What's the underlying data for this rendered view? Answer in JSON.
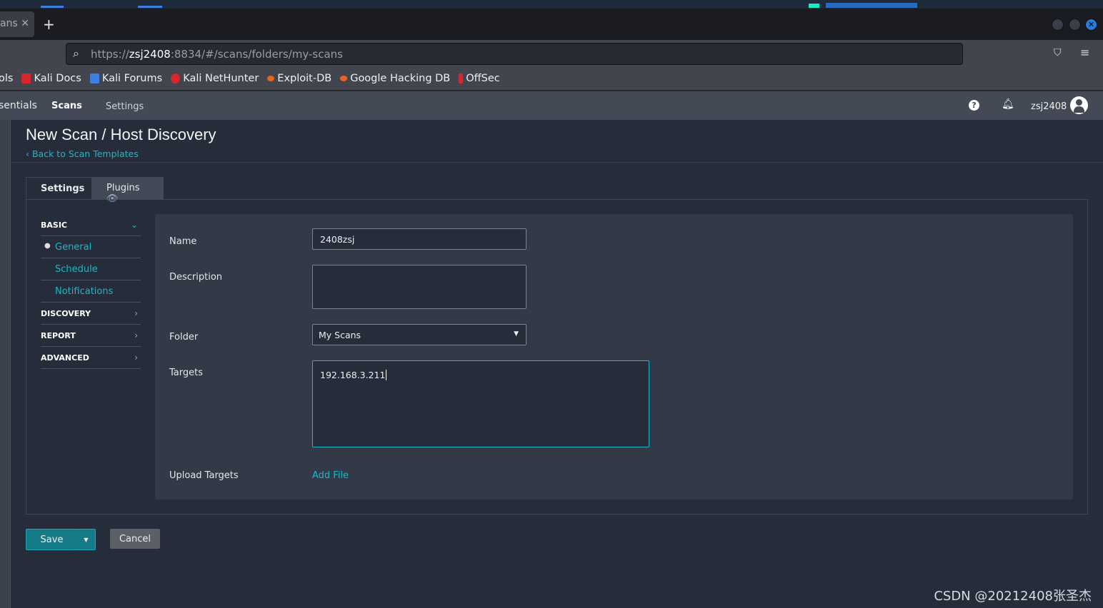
{
  "browser": {
    "tab_title": "ans",
    "url_prefix": "https://",
    "url_host": "zsj2408",
    "url_rest": ":8834/#/scans/folders/my-scans",
    "bookmarks": [
      {
        "label": "ols",
        "color": ""
      },
      {
        "label": "Kali Docs",
        "color": "#d7262e"
      },
      {
        "label": "Kali Forums",
        "color": "#3d7fe0"
      },
      {
        "label": "Kali NetHunter",
        "color": "#d7262e"
      },
      {
        "label": "Exploit-DB",
        "color": "#e8641e"
      },
      {
        "label": "Google Hacking DB",
        "color": "#e8641e"
      },
      {
        "label": "OffSec",
        "color": "#d7262e"
      }
    ]
  },
  "appnav": {
    "items": [
      "sentials",
      "Scans",
      "Settings"
    ],
    "active": "Scans",
    "username": "zsj2408"
  },
  "page": {
    "title": "New Scan / Host Discovery",
    "back_link": "Back to Scan Templates"
  },
  "tabs": {
    "settings": "Settings",
    "plugins": "Plugins"
  },
  "sidebar": {
    "basic": "BASIC",
    "sub": [
      "General",
      "Schedule",
      "Notifications"
    ],
    "sections": [
      "DISCOVERY",
      "REPORT",
      "ADVANCED"
    ]
  },
  "form": {
    "name_label": "Name",
    "name_value": "2408zsj",
    "description_label": "Description",
    "description_value": "",
    "folder_label": "Folder",
    "folder_value": "My Scans",
    "targets_label": "Targets",
    "targets_value": "192.168.3.211",
    "upload_label": "Upload Targets",
    "upload_link": "Add File"
  },
  "actions": {
    "save": "Save",
    "cancel": "Cancel"
  },
  "watermark": "CSDN @20212408张圣杰",
  "colors": {
    "accent": "#22b5c8",
    "save_button": "#167b88"
  }
}
